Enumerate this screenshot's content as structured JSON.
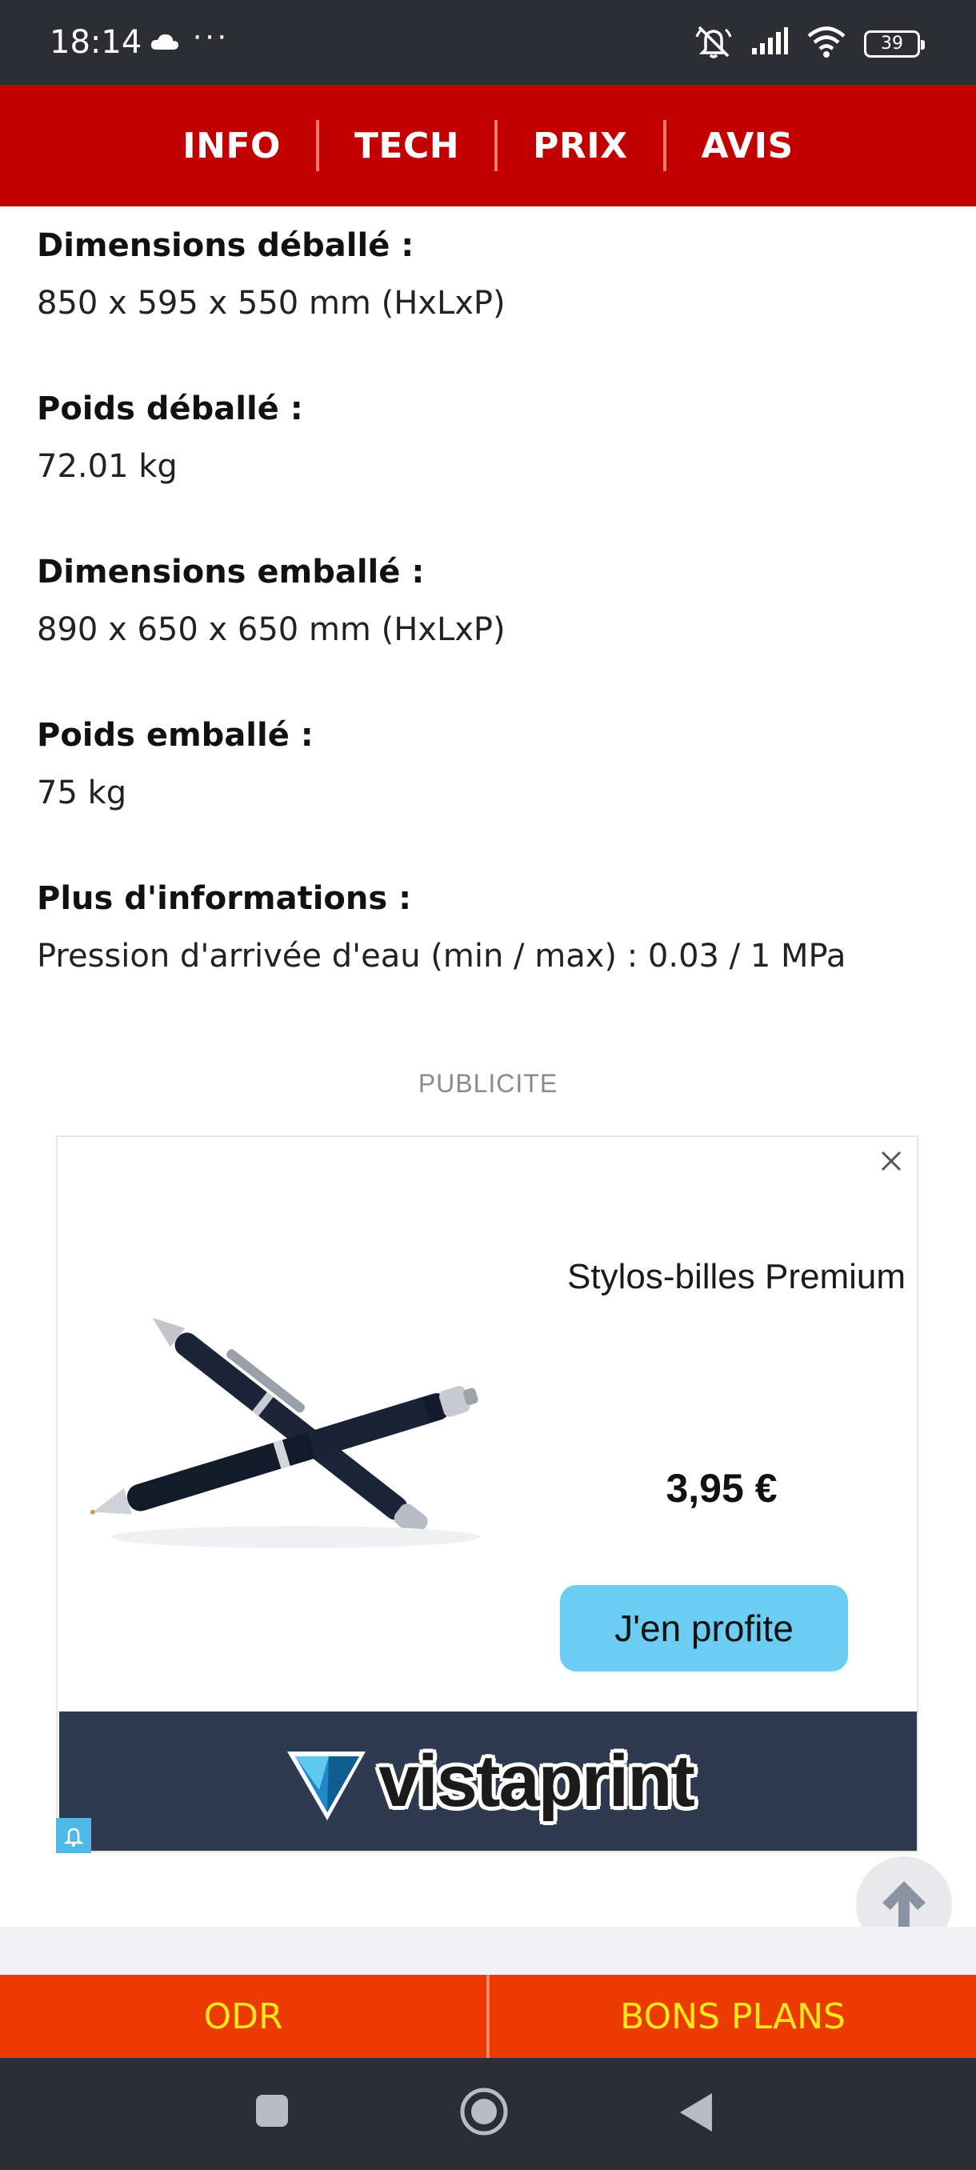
{
  "status_bar": {
    "time": "18:14",
    "dots": "···",
    "battery": "39",
    "icons": [
      "cloud-icon",
      "mute-icon",
      "signal-icon",
      "wifi-icon",
      "battery-icon"
    ]
  },
  "nav": {
    "tabs": [
      {
        "label": "INFO"
      },
      {
        "label": "TECH"
      },
      {
        "label": "PRIX"
      },
      {
        "label": "AVIS"
      }
    ]
  },
  "specs": [
    {
      "label": "Dimensions déballé :",
      "value": "850 x 595 x 550 mm (HxLxP)"
    },
    {
      "label": "Poids déballé :",
      "value": "72.01 kg"
    },
    {
      "label": "Dimensions emballé :",
      "value": "890 x 650 x 650 mm (HxLxP)"
    },
    {
      "label": "Poids emballé :",
      "value": "75 kg"
    },
    {
      "label": "Plus d'informations :",
      "value": "Pression d'arrivée d'eau (min / max) : 0.03 / 1 MPa"
    }
  ],
  "ad": {
    "label": "PUBLICITE",
    "title": "Stylos-billes Premium",
    "price": "3,95 €",
    "cta": "J'en profite",
    "brand": "vistaprint",
    "colors": {
      "cta": "#6ccdf2",
      "brand_bg": "#2e3a52"
    }
  },
  "bottom_bar": {
    "left": "ODR",
    "right": "BONS PLANS",
    "colors": {
      "bg": "#ec3b00",
      "text": "#ffe81a"
    }
  },
  "colors": {
    "nav_bg": "#c30000"
  }
}
